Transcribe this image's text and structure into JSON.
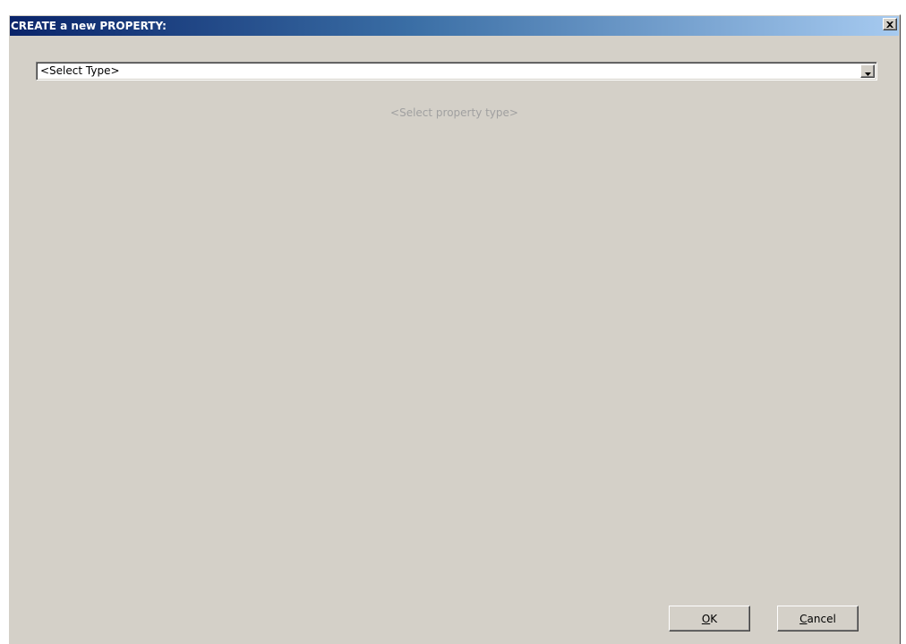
{
  "window": {
    "title": "CREATE a new PROPERTY:",
    "close_icon": "close-icon"
  },
  "type_select": {
    "value": "<Select Type>",
    "arrow_icon": "dropdown-arrow-icon"
  },
  "hint": {
    "text": "<Select property type>"
  },
  "buttons": {
    "ok": {
      "accel": "O",
      "rest": "K"
    },
    "cancel": {
      "accel": "C",
      "rest": "ancel"
    }
  },
  "colors": {
    "dialog_background": "#d4d0c8",
    "titlebar_start": "#0a246a",
    "titlebar_end": "#a6caf0",
    "hint_text": "#a0a0a0"
  }
}
